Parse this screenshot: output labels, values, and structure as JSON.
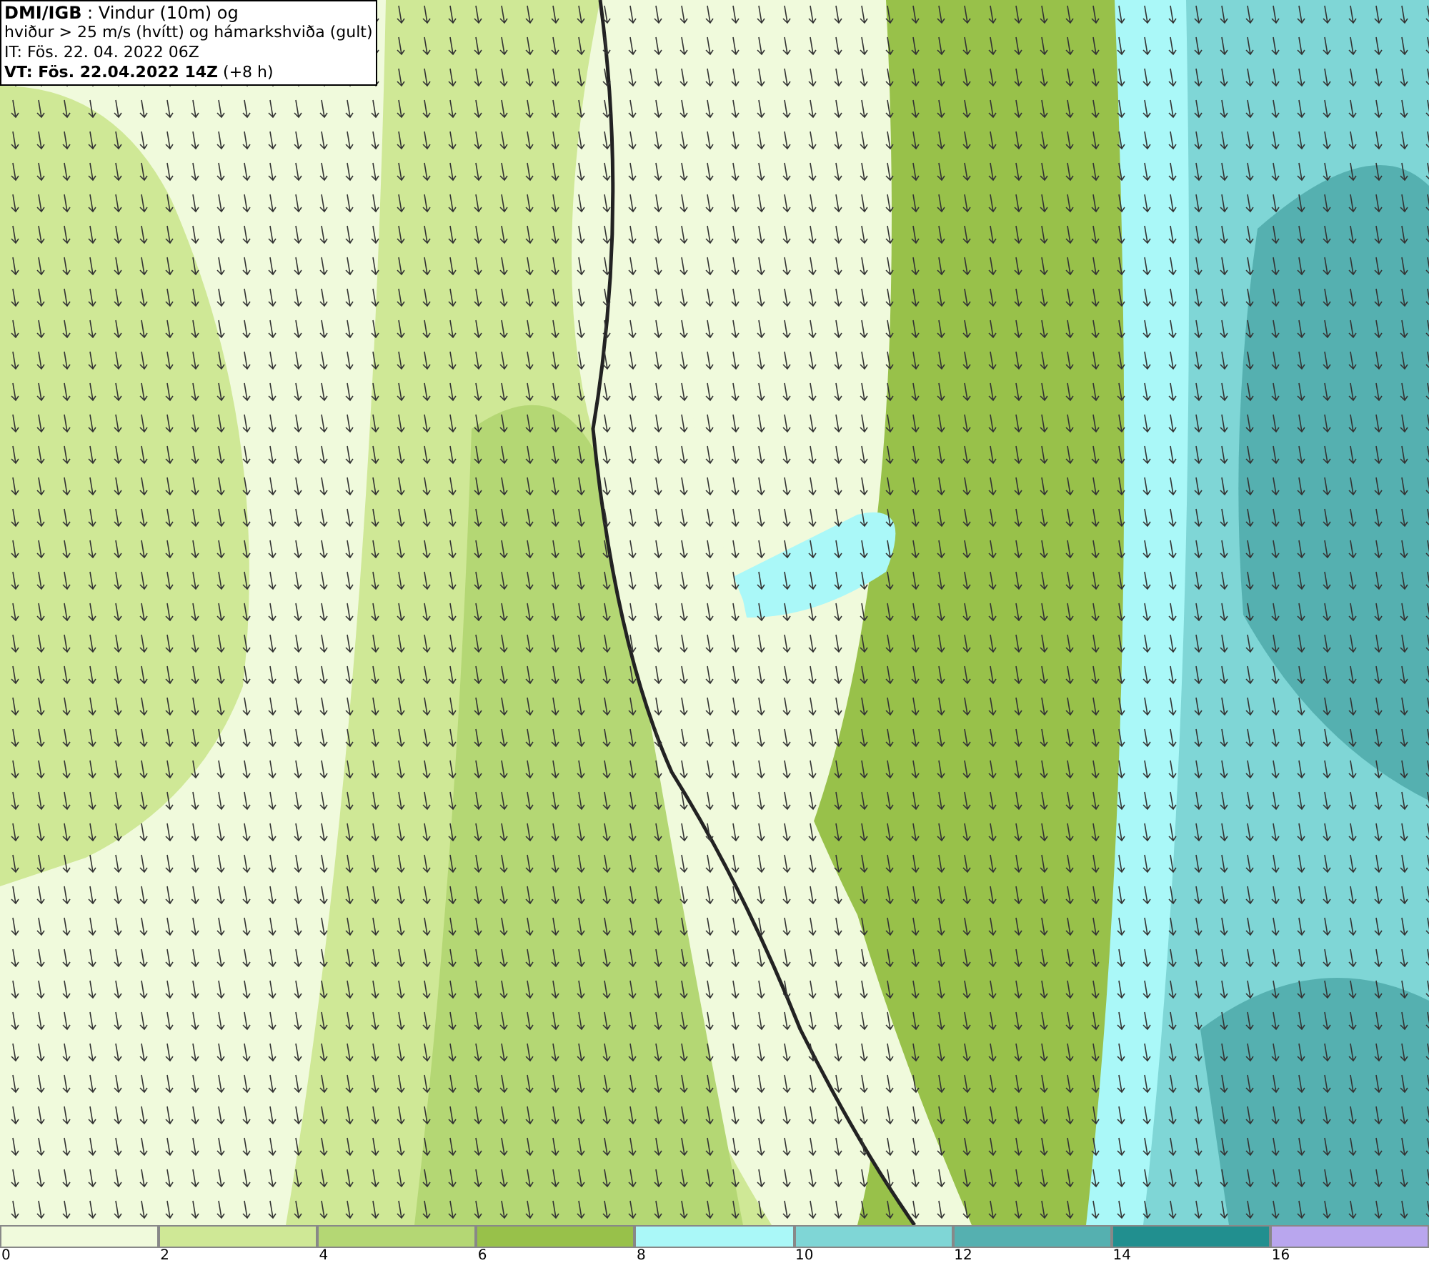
{
  "legend_box": {
    "lines": [
      "**DMI/IGB** : Vindur (10m) og",
      "hviður > 25 m/s (hvítt) og hámarkshviða (gult)",
      "IT: Fös. 22. 04. 2022 06Z",
      "**VT: Fös. 22.04.2022 14Z** (+8 h)"
    ]
  },
  "colorbar": [
    {
      "label": "0",
      "color": "#f0fadc"
    },
    {
      "label": "2",
      "color": "#cfe896"
    },
    {
      "label": "4",
      "color": "#b4d774"
    },
    {
      "label": "6",
      "color": "#98c14a"
    },
    {
      "label": "8",
      "color": "#aaf8f8"
    },
    {
      "label": "10",
      "color": "#7fd6d6"
    },
    {
      "label": "12",
      "color": "#55b0b0"
    },
    {
      "label": "14",
      "color": "#218f8f"
    },
    {
      "label": "16",
      "color": "#b9a6ee"
    }
  ]
}
